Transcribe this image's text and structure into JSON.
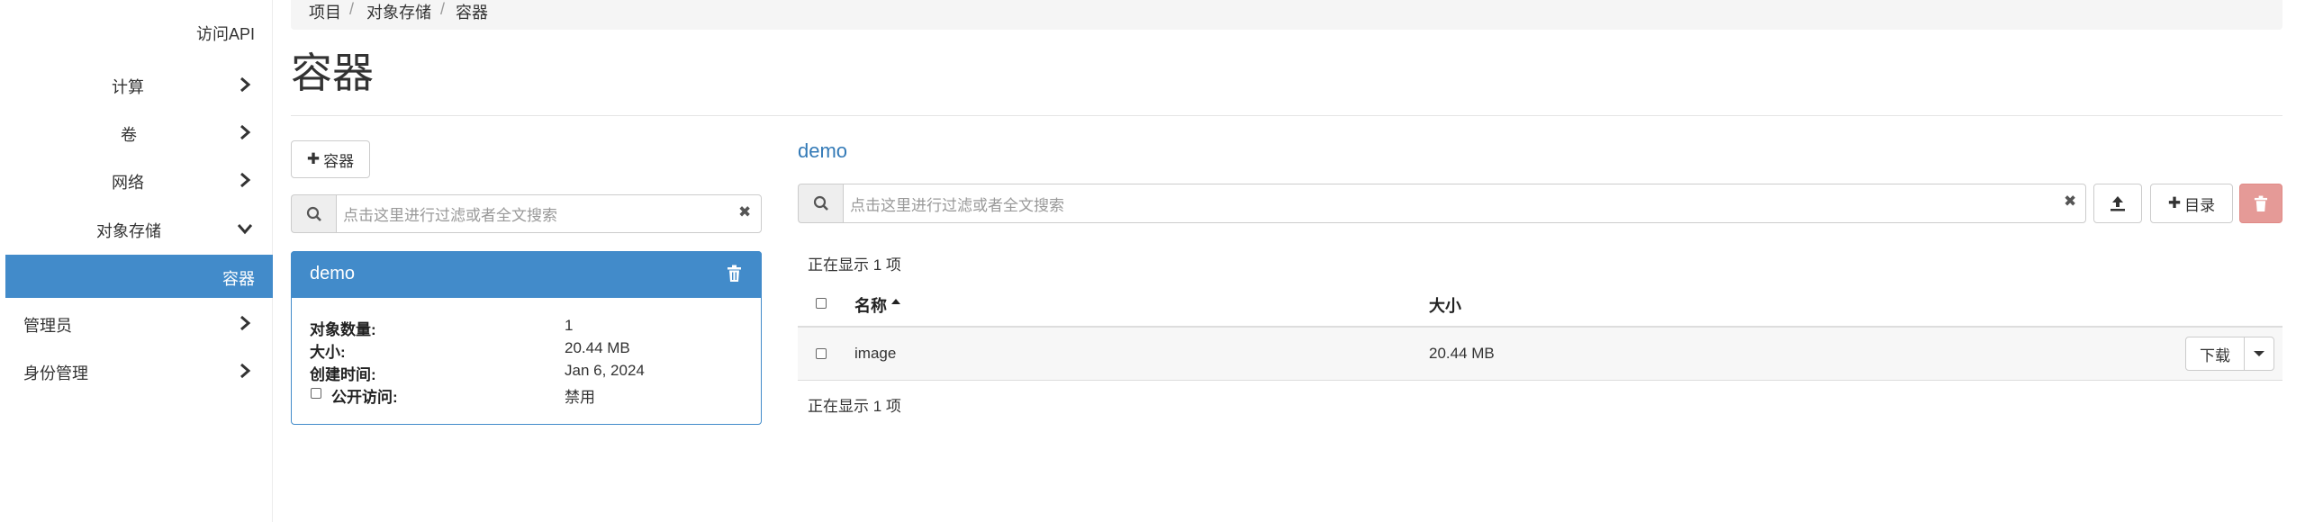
{
  "sidebar": {
    "api_access": "访问API",
    "items": [
      {
        "label": "计算"
      },
      {
        "label": "卷"
      },
      {
        "label": "网络"
      },
      {
        "label": "对象存储"
      },
      {
        "label": "容器"
      },
      {
        "label": "管理员"
      },
      {
        "label": "身份管理"
      }
    ]
  },
  "breadcrumb": [
    "项目",
    "对象存储",
    "容器"
  ],
  "breadcrumb_sep": "/",
  "page_title": "容器",
  "left": {
    "add_container_label": "容器",
    "search_placeholder": "点击这里进行过滤或者全文搜索",
    "clear_glyph": "✖",
    "container": {
      "name": "demo",
      "fields": [
        {
          "key": "对象数量:",
          "value": "1"
        },
        {
          "key": "大小:",
          "value": "20.44 MB"
        },
        {
          "key": "创建时间:",
          "value": "Jan 6, 2024"
        },
        {
          "key": "公开访问:",
          "value": "禁用"
        }
      ]
    }
  },
  "right": {
    "container_link": "demo",
    "search_placeholder": "点击这里进行过滤或者全文搜索",
    "clear_glyph": "✖",
    "add_folder_label": "目录",
    "showing_top": "正在显示 1 项",
    "showing_bottom": "正在显示 1 项",
    "columns": {
      "name": "名称",
      "size": "大小"
    },
    "rows": [
      {
        "name": "image",
        "size": "20.44 MB",
        "action": "下载"
      }
    ]
  },
  "colors": {
    "accent": "#428bca",
    "link": "#337ab7",
    "danger": "#e59a97"
  }
}
